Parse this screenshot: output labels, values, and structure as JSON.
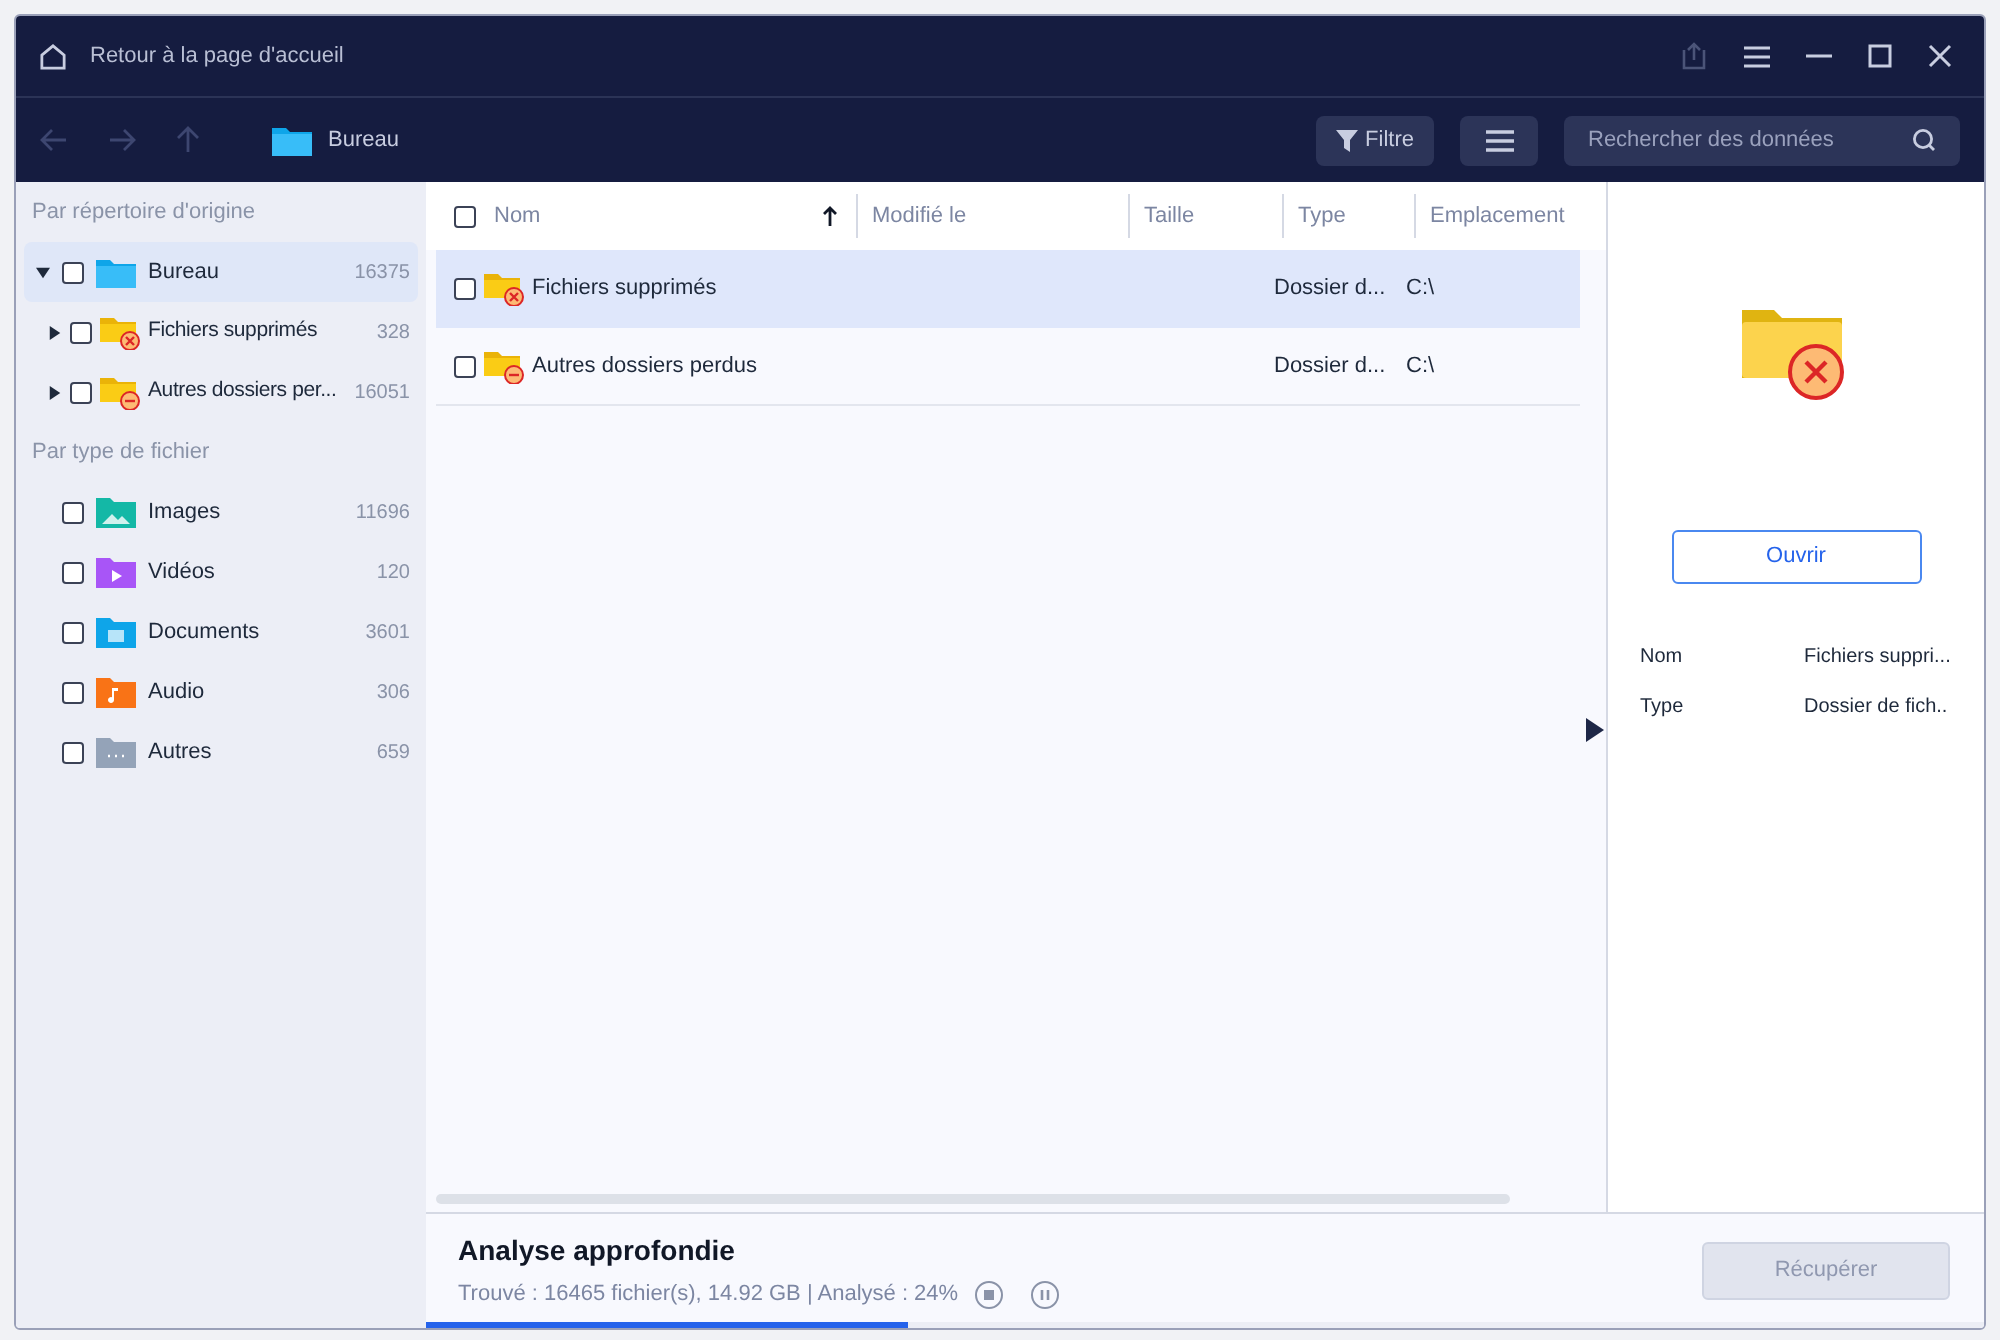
{
  "title_bar": {
    "home_link": "Retour à la page d'accueil"
  },
  "toolbar": {
    "location": "Bureau",
    "filter_button": "Filtre",
    "search": {
      "placeholder": "Rechercher des données"
    }
  },
  "sidebar": {
    "sections": [
      {
        "title": "Par répertoire d'origine",
        "items": [
          {
            "label": "Bureau",
            "count": "16375",
            "kind": "desktop",
            "selected": true,
            "checked": false,
            "expanded": true,
            "children": [
              {
                "label": "Fichiers supprimés",
                "count": "328",
                "kind": "deleted",
                "selected": false,
                "checked": false,
                "expanded": false
              },
              {
                "label": "Autres dossiers per...",
                "count": "16051",
                "kind": "lost",
                "selected": false,
                "checked": false,
                "expanded": false
              }
            ]
          }
        ]
      },
      {
        "title": "Par type de fichier",
        "items": [
          {
            "label": "Images",
            "count": "11696",
            "kind": "images",
            "selected": false,
            "checked": false
          },
          {
            "label": "Vidéos",
            "count": "120",
            "kind": "videos",
            "selected": false,
            "checked": false
          },
          {
            "label": "Documents",
            "count": "3601",
            "kind": "documents",
            "selected": false,
            "checked": false
          },
          {
            "label": "Audio",
            "count": "306",
            "kind": "audio",
            "selected": false,
            "checked": false
          },
          {
            "label": "Autres",
            "count": "659",
            "kind": "other",
            "selected": false,
            "checked": false
          }
        ]
      }
    ]
  },
  "table": {
    "select_all_checked": false,
    "columns": [
      "Nom",
      "Modifié le",
      "Taille",
      "Type",
      "Emplacement"
    ],
    "rows": [
      {
        "name": "Fichiers supprimés",
        "kind": "deleted",
        "type": "Dossier d...",
        "location": "C:\\",
        "selected": true,
        "checked": false
      },
      {
        "name": "Autres dossiers perdus",
        "kind": "lost",
        "type": "Dossier d...",
        "location": "C:\\",
        "selected": false,
        "checked": false
      }
    ]
  },
  "details": {
    "kind": "deleted",
    "open_button": "Ouvrir",
    "fields": [
      {
        "label": "Nom",
        "value": "Fichiers suppri..."
      },
      {
        "label": "Type",
        "value": "Dossier de fich.."
      }
    ]
  },
  "status": {
    "title": "Analyse approfondie",
    "summary": "Trouvé : 16465 fichier(s), 14.92 GB | Analysé : 24%",
    "level": 0.31,
    "recover_button": "Récupérer",
    "recover_disabled": true
  }
}
